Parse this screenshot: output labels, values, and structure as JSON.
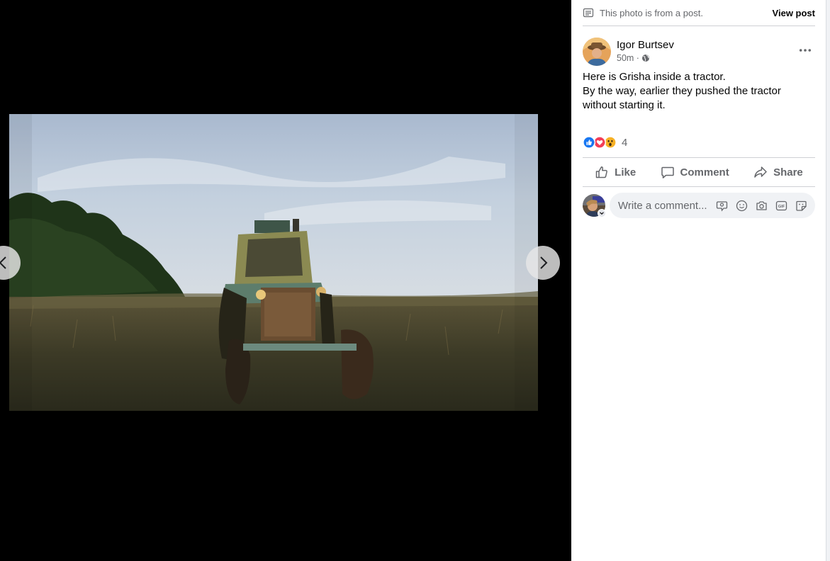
{
  "viewer": {
    "prev_icon": "chevron-left-icon",
    "next_icon": "chevron-right-icon",
    "photo_subject": "tractor"
  },
  "sidebar": {
    "from_post_text": "This photo is from a post.",
    "view_post_label": "View post",
    "author": {
      "name": "Igor Burtsev",
      "time": "50m ·",
      "privacy_icon": "globe-icon"
    },
    "post_text_lines": [
      "Here is Grisha inside a tractor.",
      "By the way, earlier they pushed the tractor",
      "without starting it."
    ],
    "reactions": {
      "types": [
        "like",
        "love",
        "wow"
      ],
      "count": "4"
    },
    "actions": {
      "like": "Like",
      "comment": "Comment",
      "share": "Share"
    },
    "comment": {
      "placeholder": "Write a comment...",
      "icons": [
        "avatar-sticker-icon",
        "emoji-icon",
        "camera-icon",
        "gif-icon",
        "sticker-icon"
      ]
    }
  },
  "colors": {
    "viewer_bg": "#000000",
    "secondary_text": "#65676b",
    "like_blue": "#1877f2",
    "love_red": "#f33e58",
    "wow_yellow": "#f7b125",
    "divider": "#ced0d4",
    "input_bg": "#f0f2f5"
  }
}
